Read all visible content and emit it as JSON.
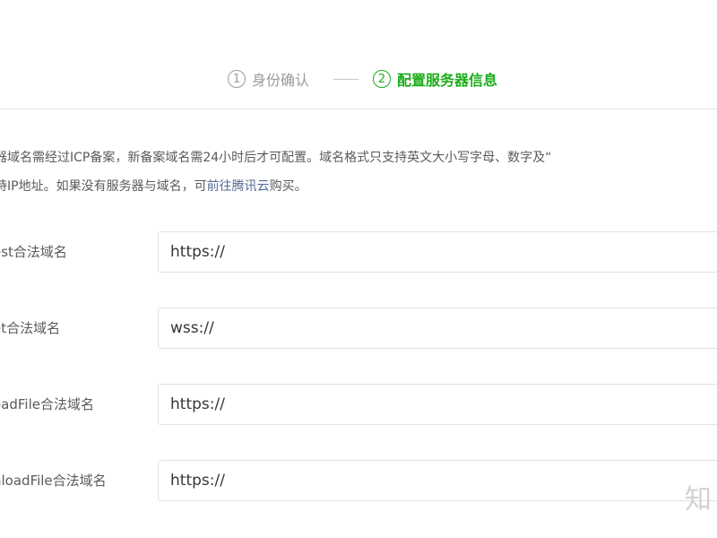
{
  "steps": {
    "step1": {
      "number": "1",
      "label": "身份确认"
    },
    "step2": {
      "number": "2",
      "label": "配置服务器信息"
    },
    "active_color": "#1aad19",
    "inactive_color": "#9a9a9a"
  },
  "notice": {
    "line1": "器域名需经过ICP备案，新备案域名需24小时后才可配置。域名格式只支持英文大小写字母、数字及“",
    "line2_prefix": "持IP地址。如果没有服务器与域名，可",
    "line2_link": "前往腾讯云",
    "line2_suffix": "购买。",
    "link_color": "#576b95"
  },
  "form": {
    "rows": [
      {
        "label": "est合法域名",
        "value": "https://"
      },
      {
        "label": "et合法域名",
        "value": "wss://"
      },
      {
        "label": "oadFile合法域名",
        "value": "https://"
      },
      {
        "label": "nloadFile合法域名",
        "value": "https://"
      }
    ]
  },
  "watermark": {
    "text": "知"
  }
}
